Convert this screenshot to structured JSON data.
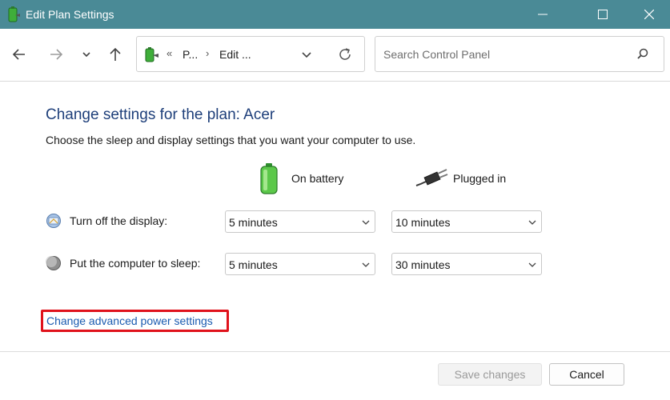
{
  "window": {
    "title": "Edit Plan Settings",
    "title_bar_color": "#4a8a96"
  },
  "navigation": {
    "back_icon": "arrow-left-icon",
    "forward_icon": "arrow-right-icon",
    "recent_icon": "chevron-down-icon",
    "up_icon": "arrow-up-icon"
  },
  "address_bar": {
    "chevron": "«",
    "segments": [
      "P...",
      "Edit ..."
    ],
    "separator": "›",
    "refresh_icon": "refresh-icon"
  },
  "search": {
    "placeholder": "Search Control Panel",
    "icon": "search-icon"
  },
  "main": {
    "heading": "Change settings for the plan: Acer",
    "subtitle": "Choose the sleep and display settings that you want your computer to use.",
    "columns": {
      "on_battery": "On battery",
      "plugged_in": "Plugged in"
    },
    "rows": [
      {
        "label": "Turn off the display:",
        "icon": "display-icon",
        "on_battery": "5 minutes",
        "plugged_in": "10 minutes"
      },
      {
        "label": "Put the computer to sleep:",
        "icon": "sleep-moon-icon",
        "on_battery": "5 minutes",
        "plugged_in": "30 minutes"
      }
    ],
    "advanced_link": "Change advanced power settings",
    "highlight_color": "#e0121b",
    "heading_color": "#1e3f7a",
    "link_color": "#1a5bb0"
  },
  "footer": {
    "save_label": "Save changes",
    "cancel_label": "Cancel",
    "save_enabled": false
  }
}
